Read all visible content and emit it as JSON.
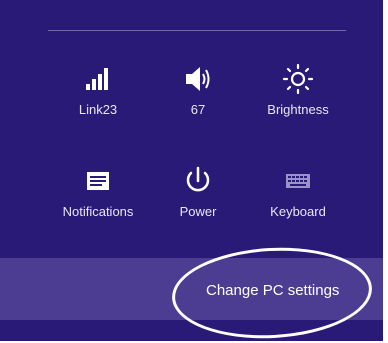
{
  "colors": {
    "panel_bg": "#2a1a78",
    "footer_bg": "#4c3d93",
    "text": "#ffffff"
  },
  "tiles": [
    {
      "label": "Link23",
      "icon": "signal-bars-icon"
    },
    {
      "label": "67",
      "icon": "speaker-volume-icon"
    },
    {
      "label": "Brightness",
      "icon": "brightness-sun-icon"
    },
    {
      "label": "Notifications",
      "icon": "notifications-icon"
    },
    {
      "label": "Power",
      "icon": "power-icon"
    },
    {
      "label": "Keyboard",
      "icon": "keyboard-icon"
    }
  ],
  "footer": {
    "label": "Change PC settings"
  }
}
